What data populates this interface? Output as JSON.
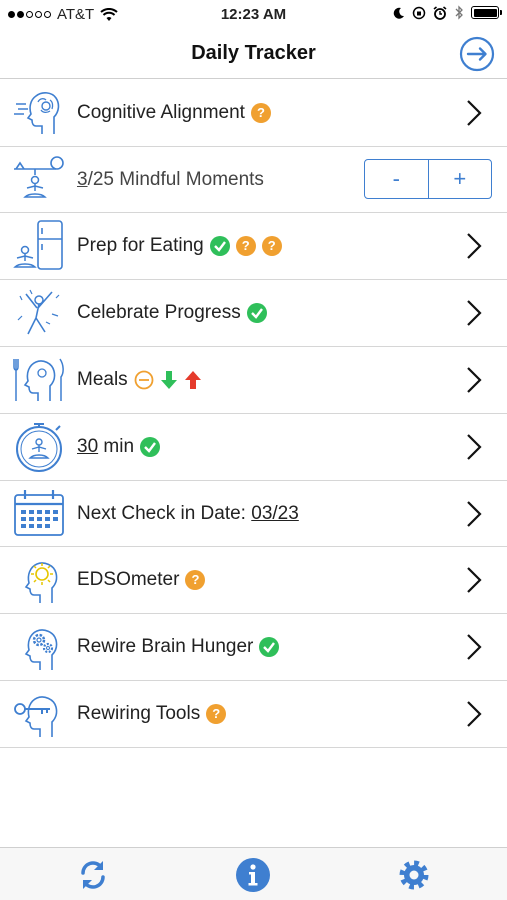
{
  "status_bar": {
    "carrier": "AT&T",
    "time": "12:23 AM"
  },
  "nav": {
    "title": "Daily Tracker"
  },
  "colors": {
    "accent": "#3f7fd0",
    "question_badge": "#f0a030",
    "check_badge": "#2fbf5a",
    "down_arrow": "#2fbf5a",
    "up_arrow": "#e53b2c"
  },
  "rows": [
    {
      "label": "Cognitive Alignment",
      "icon": "brain-profile-icon",
      "badges": [
        "question"
      ]
    },
    {
      "count": "3",
      "label": "/25 Mindful Moments",
      "icon": "meditation-balance-icon",
      "stepper": {
        "minus": "-",
        "plus": "+"
      }
    },
    {
      "label": "Prep for Eating",
      "icon": "fridge-meditation-icon",
      "badges": [
        "check",
        "question",
        "question"
      ]
    },
    {
      "label": "Celebrate Progress",
      "icon": "celebrating-figure-icon",
      "badges": [
        "check"
      ]
    },
    {
      "label": "Meals",
      "icon": "head-fork-knife-icon",
      "badges": [
        "neutral",
        "down",
        "up"
      ]
    },
    {
      "count": "30",
      "label": " min",
      "icon": "stopwatch-meditation-icon",
      "badges": [
        "check"
      ]
    },
    {
      "label": "Next Check in Date: ",
      "date": "03/23",
      "icon": "calendar-icon"
    },
    {
      "label": "EDSOmeter",
      "icon": "head-sun-icon",
      "badges": [
        "question"
      ]
    },
    {
      "label": "Rewire Brain Hunger",
      "icon": "head-gears-icon",
      "badges": [
        "check"
      ]
    },
    {
      "label": "Rewiring Tools",
      "icon": "head-key-icon",
      "badges": [
        "question"
      ]
    }
  ],
  "tab_bar": {
    "items": [
      "refresh-icon",
      "info-icon",
      "settings-gear-icon"
    ]
  }
}
